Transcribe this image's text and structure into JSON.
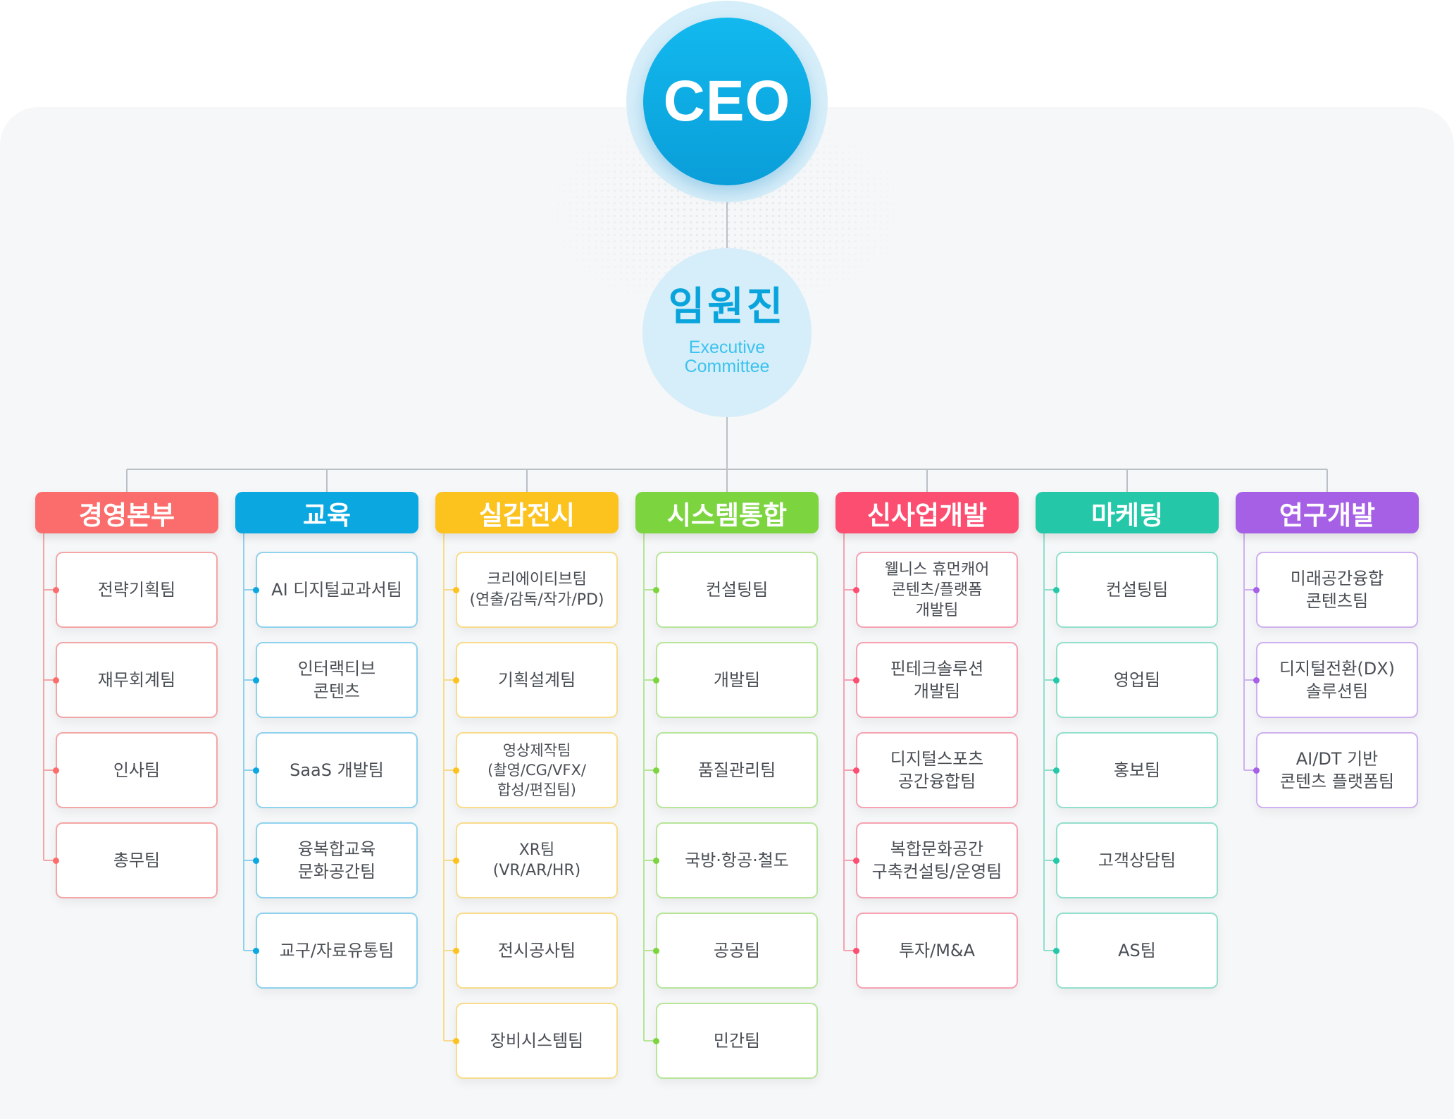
{
  "ceo": {
    "label": "CEO"
  },
  "executive": {
    "title": "임원진",
    "subtitle_line1": "Executive",
    "subtitle_line2": "Committee"
  },
  "departments": [
    {
      "name": "경영본부",
      "color": "#fb6d6d",
      "line": "#f4a6a6",
      "teams": [
        "전략기획팀",
        "재무회계팀",
        "인사팀",
        "총무팀"
      ]
    },
    {
      "name": "교육",
      "color": "#0aa7e0",
      "line": "#8fd2ee",
      "teams": [
        "AI 디지털교과서팀",
        "인터랙티브\n콘텐츠",
        "SaaS 개발팀",
        "융복합교육\n문화공간팀",
        "교구/자료유통팀"
      ]
    },
    {
      "name": "실감전시",
      "color": "#fcc21e",
      "line": "#f8dc8c",
      "teams": [
        "크리에이티브팀\n(연출/감독/작가/PD)",
        "기획설계팀",
        "영상제작팀\n(촬영/CG/VFX/\n합성/편집팀)",
        "XR팀\n(VR/AR/HR)",
        "전시공사팀",
        "장비시스템팀"
      ]
    },
    {
      "name": "시스템통합",
      "color": "#7cd43f",
      "line": "#b7e59a",
      "teams": [
        "컨설팅팀",
        "개발팀",
        "품질관리팀",
        "국방·항공·철도",
        "공공팀",
        "민간팀"
      ]
    },
    {
      "name": "신사업개발",
      "color": "#fc4e71",
      "line": "#f6a2b3",
      "teams": [
        "웰니스 휴먼캐어\n콘텐츠/플랫폼\n개발팀",
        "핀테크솔루션\n개발팀",
        "디지털스포츠\n공간융합팀",
        "복합문화공간\n구축컨설팅/운영팀",
        "투자/M&A"
      ]
    },
    {
      "name": "마케팅",
      "color": "#24c8a8",
      "line": "#93dfcd",
      "teams": [
        "컨설팅팀",
        "영업팀",
        "홍보팀",
        "고객상담팀",
        "AS팀"
      ]
    },
    {
      "name": "연구개발",
      "color": "#a660e6",
      "line": "#cfb0f0",
      "teams": [
        "미래공간융합\n콘텐츠팀",
        "디지털전환(DX)\n솔루션팀",
        "AI/DT 기반\n콘텐츠 플랫폼팀"
      ]
    }
  ]
}
